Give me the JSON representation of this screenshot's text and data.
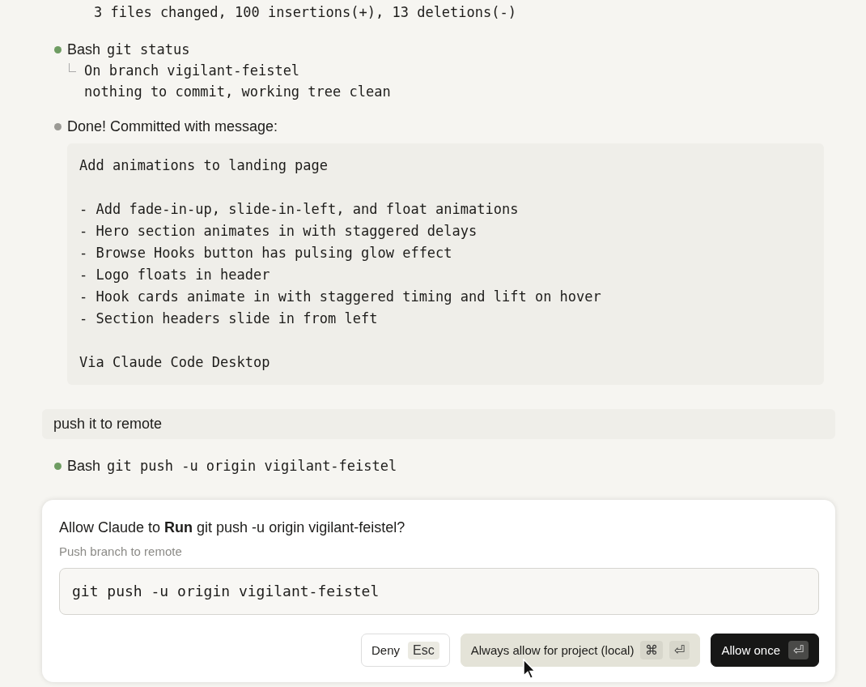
{
  "transcript": [
    {
      "kind": "output",
      "lines": [
        "3 files changed, 100 insertions(+), 13 deletions(-)"
      ]
    },
    {
      "kind": "tool",
      "tool": "Bash",
      "command": "git status",
      "color": "#6e9c62",
      "output": [
        "On branch vigilant-feistel",
        "nothing to commit, working tree clean"
      ]
    },
    {
      "kind": "message",
      "text": "Done! Committed with message:",
      "color": "#9b9a95",
      "code": [
        [
          "Add animations to landing page"
        ],
        [
          "- Add fade-in-up, slide-in-left, and float animations",
          "- Hero section animates in with staggered delays",
          "- Browse Hooks button has pulsing glow effect",
          "- Logo floats in header",
          "- Hook cards animate in with staggered timing and lift on hover",
          "- Section headers slide in from left"
        ],
        [
          "Via Claude Code Desktop"
        ]
      ]
    },
    {
      "kind": "user",
      "text": "push it to remote"
    },
    {
      "kind": "tool",
      "tool": "Bash",
      "command": "git push -u origin vigilant-feistel",
      "color": "#6e9c62"
    }
  ],
  "dialog": {
    "question": "Allow Claude to **Run** git push -u origin vigilant-feistel?",
    "description": "Push branch to remote",
    "command": "git push -u origin vigilant-feistel",
    "buttons": [
      {
        "label": "Deny",
        "keys": [
          "Esc"
        ],
        "kind": "secondary"
      },
      {
        "label": "Always allow for project (local)",
        "keys": [
          "⌘",
          "⏎"
        ],
        "kind": "tertiary"
      },
      {
        "label": "Allow once",
        "keys": [
          "⏎"
        ],
        "kind": "primary"
      }
    ]
  }
}
